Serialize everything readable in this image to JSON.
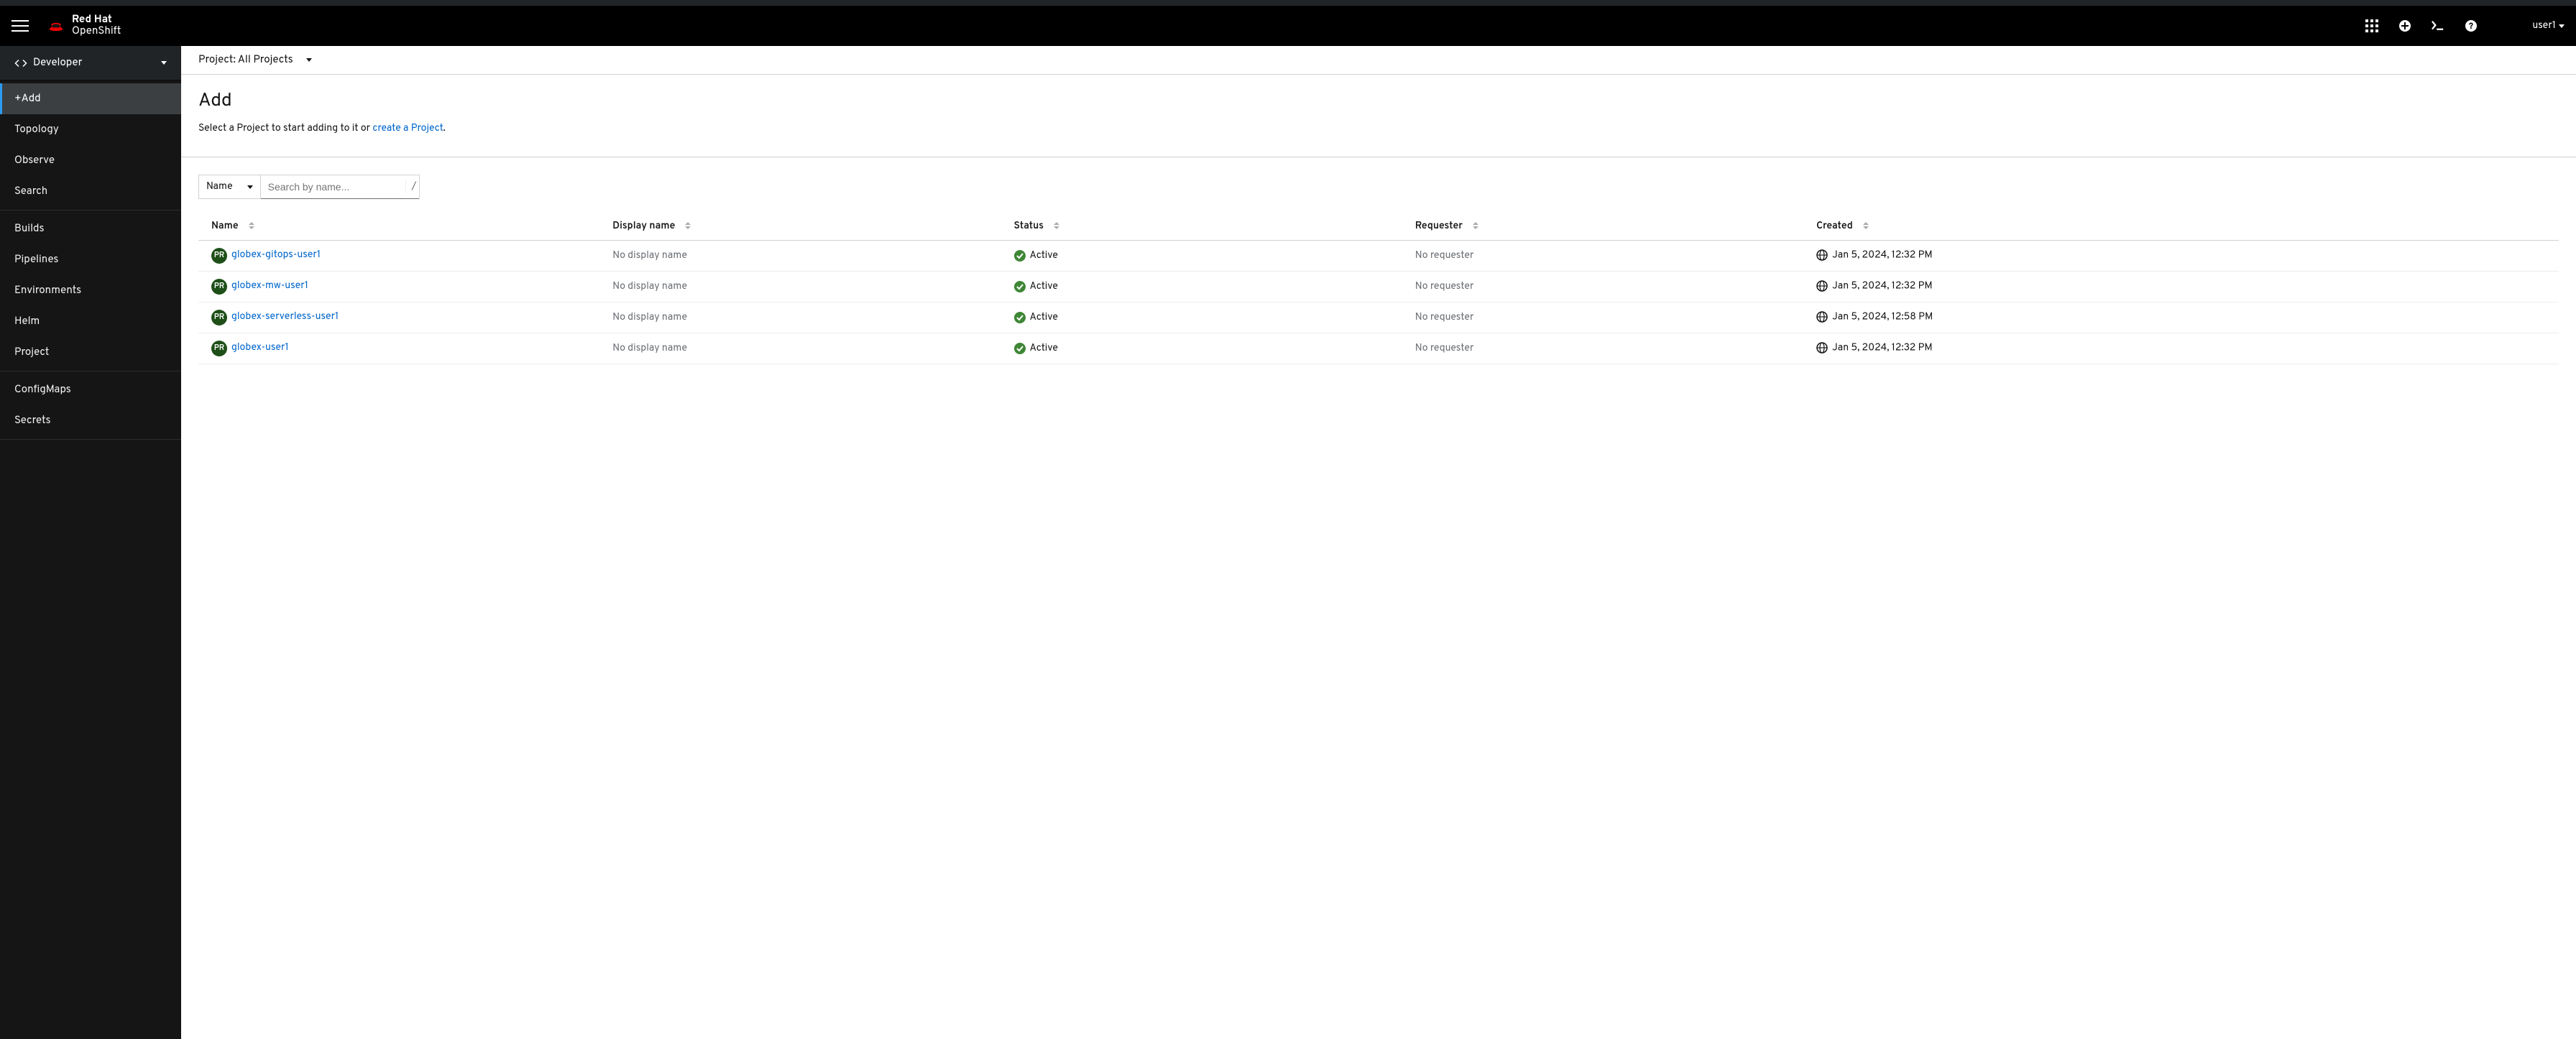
{
  "brand": {
    "line1": "Red Hat",
    "line2": "OpenShift"
  },
  "user": {
    "name": "user1"
  },
  "perspective": {
    "label": "Developer"
  },
  "sidebar": {
    "groups": [
      {
        "items": [
          {
            "label": "+Add",
            "active": true
          },
          {
            "label": "Topology"
          },
          {
            "label": "Observe"
          },
          {
            "label": "Search"
          }
        ]
      },
      {
        "items": [
          {
            "label": "Builds"
          },
          {
            "label": "Pipelines"
          },
          {
            "label": "Environments"
          },
          {
            "label": "Helm"
          },
          {
            "label": "Project"
          }
        ]
      },
      {
        "items": [
          {
            "label": "ConfigMaps"
          },
          {
            "label": "Secrets"
          }
        ]
      }
    ]
  },
  "projectBar": {
    "label": "Project: All Projects"
  },
  "page": {
    "title": "Add",
    "desc_prefix": "Select a Project to start adding to it or ",
    "desc_link": "create a Project",
    "desc_suffix": "."
  },
  "filter": {
    "attribute": "Name",
    "placeholder": "Search by name...",
    "shortcut": "/"
  },
  "table": {
    "columns": {
      "name": "Name",
      "display": "Display name",
      "status": "Status",
      "requester": "Requester",
      "created": "Created"
    },
    "badge": "PR",
    "rows": [
      {
        "name": "globex-gitops-user1",
        "display": "No display name",
        "status": "Active",
        "requester": "No requester",
        "created": "Jan 5, 2024, 12:32 PM"
      },
      {
        "name": "globex-mw-user1",
        "display": "No display name",
        "status": "Active",
        "requester": "No requester",
        "created": "Jan 5, 2024, 12:32 PM"
      },
      {
        "name": "globex-serverless-user1",
        "display": "No display name",
        "status": "Active",
        "requester": "No requester",
        "created": "Jan 5, 2024, 12:58 PM"
      },
      {
        "name": "globex-user1",
        "display": "No display name",
        "status": "Active",
        "requester": "No requester",
        "created": "Jan 5, 2024, 12:32 PM"
      }
    ]
  }
}
